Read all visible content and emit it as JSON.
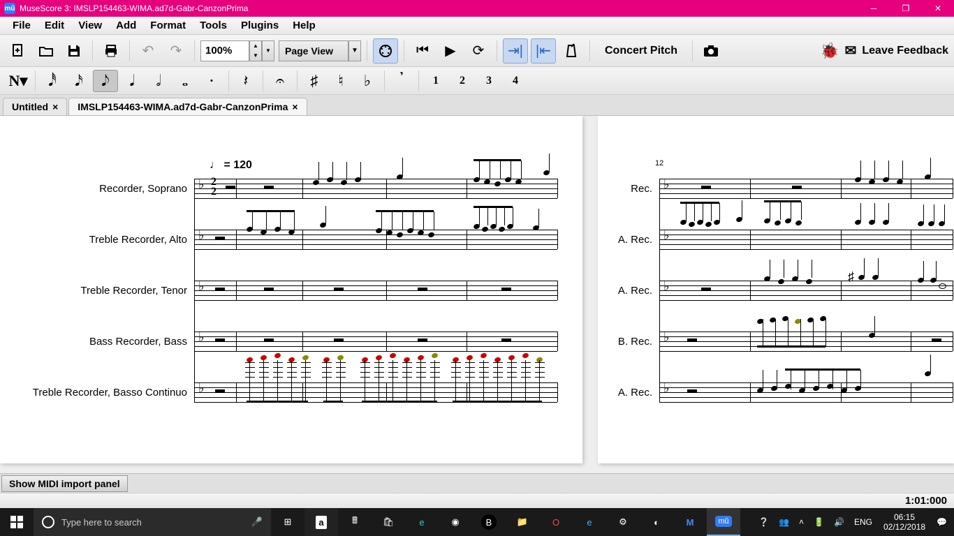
{
  "app": {
    "name": "MuseScore 3",
    "document": "IMSLP154463-WIMA.ad7d-Gabr-CanzonPrima",
    "icon_label": "mŭ"
  },
  "menu": [
    "File",
    "Edit",
    "View",
    "Add",
    "Format",
    "Tools",
    "Plugins",
    "Help"
  ],
  "toolbar": {
    "zoom": "100%",
    "view_mode": "Page View",
    "concert_pitch": "Concert Pitch",
    "leave_feedback": "Leave Feedback"
  },
  "notebar": {
    "voices": [
      "1",
      "2",
      "3",
      "4"
    ]
  },
  "tabs": [
    {
      "label": "Untitled",
      "active": false
    },
    {
      "label": "IMSLP154463-WIMA.ad7d-Gabr-CanzonPrima",
      "active": true
    }
  ],
  "score": {
    "tempo_text": "= 120",
    "tempo_note": "♩",
    "time_sig_top": "2",
    "time_sig_bottom": "2",
    "measure_number_p2": "12",
    "staves_page1": [
      "Recorder, Soprano",
      "Treble Recorder, Alto",
      "Treble Recorder, Tenor",
      "Bass Recorder, Bass",
      "Treble Recorder, Basso Continuo"
    ],
    "staves_page2": [
      "Rec.",
      "A. Rec.",
      "A. Rec.",
      "B. Rec.",
      "A. Rec."
    ]
  },
  "midi_panel": {
    "button": "Show MIDI import panel"
  },
  "status": {
    "position": "1:01:000"
  },
  "taskbar": {
    "search_placeholder": "Type here to search",
    "lang": "ENG",
    "time": "06:15",
    "date": "02/12/2018"
  }
}
